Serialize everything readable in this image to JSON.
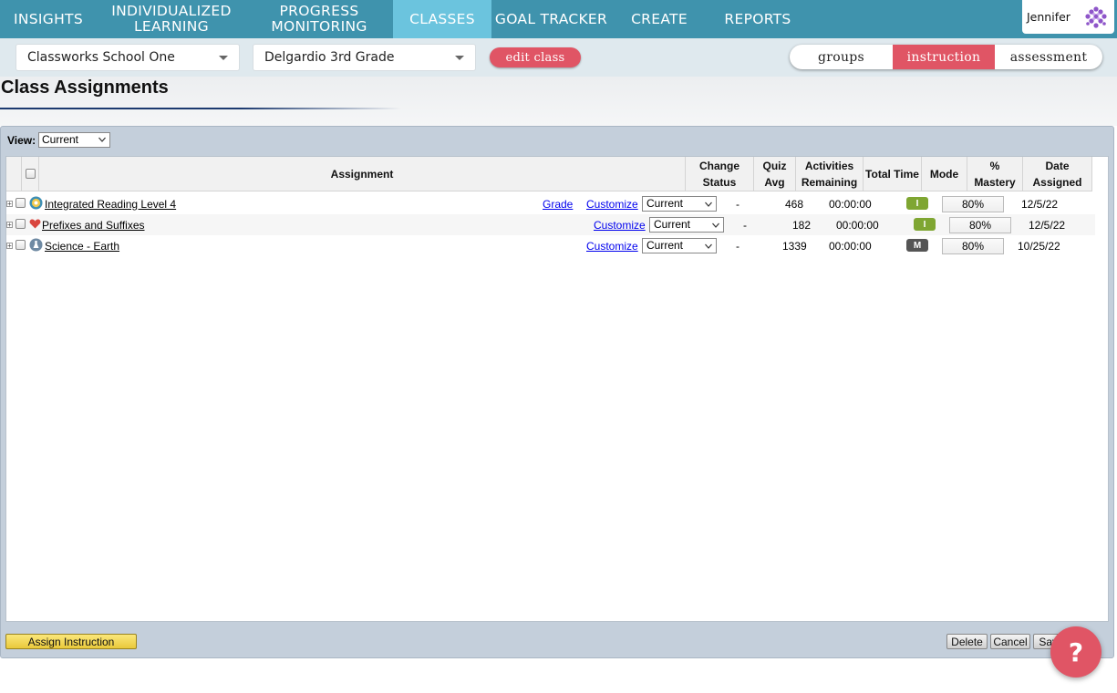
{
  "nav": {
    "insights": "INSIGHTS",
    "individualized_1": "INDIVIDUALIZED",
    "individualized_2": "LEARNING",
    "progress_1": "PROGRESS",
    "progress_2": "MONITORING",
    "classes": "CLASSES",
    "goal_tracker": "GOAL TRACKER",
    "create": "CREATE",
    "reports": "REPORTS",
    "user_name": "Jennifer",
    "active_tab": "CLASSES"
  },
  "subbar": {
    "school": "Classworks School One",
    "class_name": "Delgardio 3rd Grade",
    "edit_class": "edit class",
    "toggle": [
      "groups",
      "instruction",
      "assessment"
    ],
    "toggle_active": "instruction"
  },
  "page_title": "Class Assignments",
  "view": {
    "label": "View:",
    "value": "Current"
  },
  "table": {
    "headers": {
      "assignment": "Assignment",
      "change_status_1": "Change",
      "change_status_2": "Status",
      "quiz_avg_1": "Quiz",
      "quiz_avg_2": "Avg",
      "activities_1": "Activities",
      "activities_2": "Remaining",
      "total_time": "Total Time",
      "mode": "Mode",
      "mastery_1": "%",
      "mastery_2": "Mastery",
      "date_1": "Date",
      "date_2": "Assigned"
    },
    "rows": [
      {
        "name": "Integrated Reading Level 4",
        "icon": "reading-icon",
        "grade": "Grade",
        "customize": "Customize",
        "status": "Current",
        "quiz_avg": "-",
        "activities_remaining": "468",
        "total_time": "00:00:00",
        "mode": "I",
        "mode_color": "#7fa632",
        "mastery": "80%",
        "date_assigned": "12/5/22"
      },
      {
        "name": "Prefixes and Suffixes",
        "icon": "heart-icon",
        "customize": "Customize",
        "status": "Current",
        "quiz_avg": "-",
        "activities_remaining": "182",
        "total_time": "00:00:00",
        "mode": "I",
        "mode_color": "#7fa632",
        "mastery": "80%",
        "date_assigned": "12/5/22"
      },
      {
        "name": "Science - Earth",
        "icon": "science-icon",
        "customize": "Customize",
        "status": "Current",
        "quiz_avg": "-",
        "activities_remaining": "1339",
        "total_time": "00:00:00",
        "mode": "M",
        "mode_color": "#555555",
        "mastery": "80%",
        "date_assigned": "10/25/22"
      }
    ]
  },
  "footer": {
    "assign_instruction": "Assign Instruction",
    "delete": "Delete",
    "cancel": "Cancel",
    "save": "Save"
  },
  "help": "?",
  "colors": {
    "nav_bg": "#3f93ad",
    "nav_active": "#6bc4de",
    "accent": "#e05565",
    "panel": "#c4cfdb"
  }
}
